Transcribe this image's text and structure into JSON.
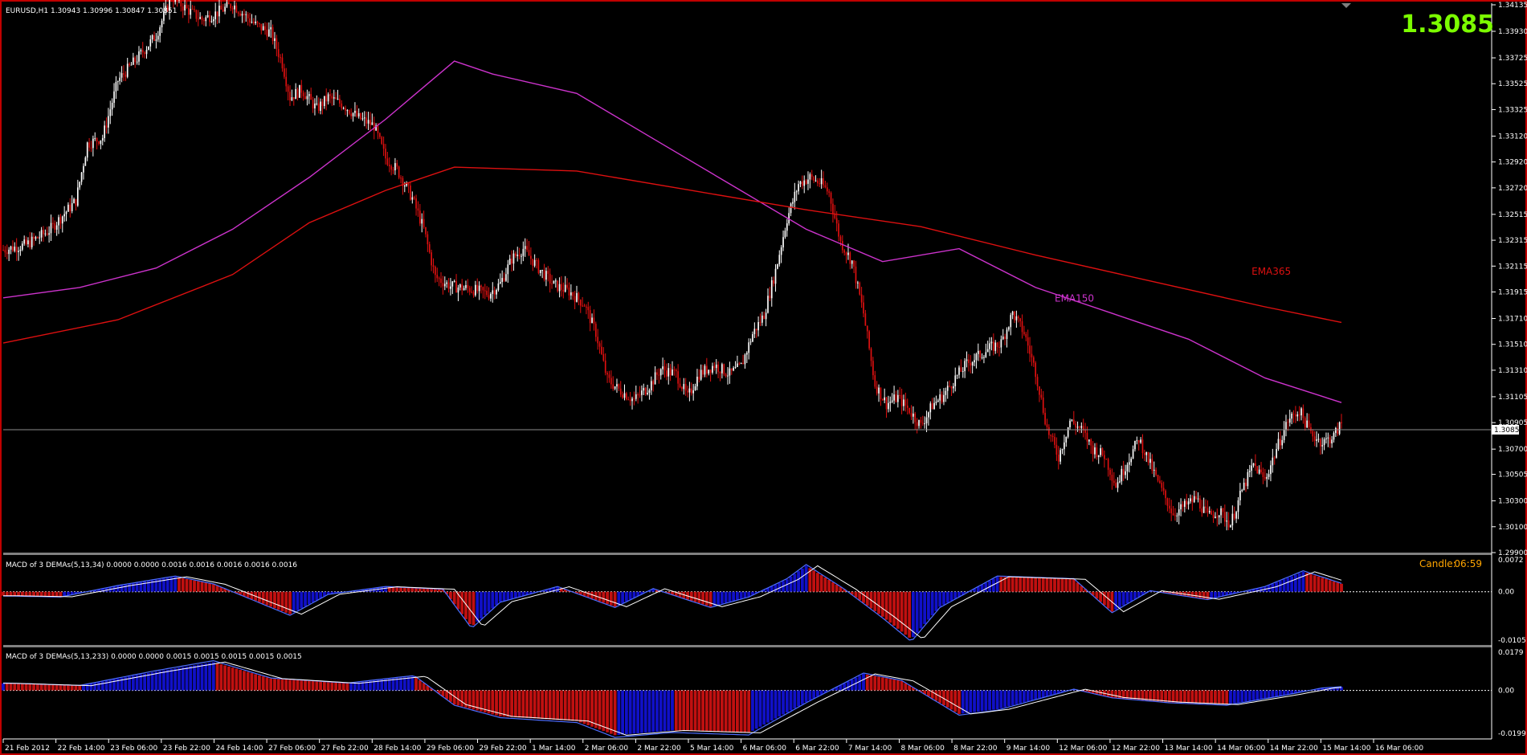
{
  "chart_data": {
    "type": "candlestick",
    "symbol_header": "EURUSD,H1  1.30943 1.30996 1.30847 1.30851",
    "big_price": "1.3085",
    "current_price_label": "1.3085",
    "colors": {
      "bull": "#ffffff",
      "bear": "#e01010",
      "ema150": "#cc33cc",
      "ema365": "#dd1010",
      "accent": "#7cfc00",
      "hist_bull": "#1010c8",
      "hist_bear": "#c01010"
    },
    "price_axis_ticks": [
      "1.34135",
      "1.33930",
      "1.33725",
      "1.33525",
      "1.33325",
      "1.33120",
      "1.32920",
      "1.32720",
      "1.32515",
      "1.32315",
      "1.32115",
      "1.31915",
      "1.31710",
      "1.31510",
      "1.31310",
      "1.31105",
      "1.30905",
      "1.30700",
      "1.30505",
      "1.30300",
      "1.30100",
      "1.29900"
    ],
    "ylim": [
      1.299,
      1.34135
    ],
    "time_labels": [
      "21 Feb 2012",
      "22 Feb 14:00",
      "23 Feb 06:00",
      "23 Feb 22:00",
      "24 Feb 14:00",
      "27 Feb 06:00",
      "27 Feb 22:00",
      "28 Feb 14:00",
      "29 Feb 06:00",
      "29 Feb 22:00",
      "1 Mar 14:00",
      "2 Mar 06:00",
      "2 Mar 22:00",
      "5 Mar 14:00",
      "6 Mar 06:00",
      "6 Mar 22:00",
      "7 Mar 14:00",
      "8 Mar 06:00",
      "8 Mar 22:00",
      "9 Mar 14:00",
      "12 Mar 06:00",
      "12 Mar 22:00",
      "13 Mar 14:00",
      "14 Mar 06:00",
      "14 Mar 22:00",
      "15 Mar 14:00",
      "16 Mar 06:00"
    ],
    "close_path": [
      [
        0,
        1.3224
      ],
      [
        12,
        1.3228
      ],
      [
        24,
        1.3239
      ],
      [
        38,
        1.3262
      ],
      [
        44,
        1.3306
      ],
      [
        52,
        1.3311
      ],
      [
        60,
        1.3355
      ],
      [
        70,
        1.3372
      ],
      [
        80,
        1.339
      ],
      [
        88,
        1.342
      ],
      [
        96,
        1.341
      ],
      [
        104,
        1.3402
      ],
      [
        110,
        1.3406
      ],
      [
        120,
        1.3414
      ],
      [
        132,
        1.3398
      ],
      [
        140,
        1.3392
      ],
      [
        146,
        1.3368
      ],
      [
        150,
        1.3342
      ],
      [
        156,
        1.3348
      ],
      [
        164,
        1.3333
      ],
      [
        170,
        1.3342
      ],
      [
        178,
        1.3336
      ],
      [
        186,
        1.3326
      ],
      [
        194,
        1.332
      ],
      [
        200,
        1.3295
      ],
      [
        206,
        1.3286
      ],
      [
        214,
        1.3264
      ],
      [
        220,
        1.324
      ],
      [
        226,
        1.3203
      ],
      [
        234,
        1.3196
      ],
      [
        244,
        1.3194
      ],
      [
        254,
        1.319
      ],
      [
        260,
        1.3198
      ],
      [
        266,
        1.3217
      ],
      [
        272,
        1.3225
      ],
      [
        280,
        1.321
      ],
      [
        288,
        1.3197
      ],
      [
        296,
        1.3192
      ],
      [
        304,
        1.3182
      ],
      [
        310,
        1.316
      ],
      [
        316,
        1.3124
      ],
      [
        322,
        1.3116
      ],
      [
        330,
        1.3108
      ],
      [
        338,
        1.3119
      ],
      [
        344,
        1.3132
      ],
      [
        352,
        1.3128
      ],
      [
        358,
        1.311
      ],
      [
        364,
        1.3128
      ],
      [
        372,
        1.3135
      ],
      [
        380,
        1.3128
      ],
      [
        386,
        1.3134
      ],
      [
        392,
        1.3159
      ],
      [
        398,
        1.3174
      ],
      [
        404,
        1.3208
      ],
      [
        410,
        1.3248
      ],
      [
        416,
        1.3275
      ],
      [
        422,
        1.328
      ],
      [
        428,
        1.3275
      ],
      [
        432,
        1.3268
      ],
      [
        438,
        1.323
      ],
      [
        444,
        1.3215
      ],
      [
        450,
        1.3175
      ],
      [
        456,
        1.312
      ],
      [
        462,
        1.3105
      ],
      [
        468,
        1.311
      ],
      [
        474,
        1.31
      ],
      [
        480,
        1.3088
      ],
      [
        486,
        1.3104
      ],
      [
        492,
        1.3112
      ],
      [
        498,
        1.3125
      ],
      [
        504,
        1.3136
      ],
      [
        510,
        1.3142
      ],
      [
        516,
        1.3148
      ],
      [
        522,
        1.3152
      ],
      [
        528,
        1.3175
      ],
      [
        534,
        1.316
      ],
      [
        540,
        1.313
      ],
      [
        546,
        1.3086
      ],
      [
        552,
        1.3064
      ],
      [
        558,
        1.3092
      ],
      [
        564,
        1.3085
      ],
      [
        570,
        1.307
      ],
      [
        576,
        1.3065
      ],
      [
        582,
        1.3042
      ],
      [
        588,
        1.306
      ],
      [
        594,
        1.3078
      ],
      [
        600,
        1.3058
      ],
      [
        606,
        1.3038
      ],
      [
        612,
        1.302
      ],
      [
        618,
        1.3026
      ],
      [
        624,
        1.3032
      ],
      [
        630,
        1.3018
      ],
      [
        636,
        1.3022
      ],
      [
        642,
        1.3012
      ],
      [
        648,
        1.3038
      ],
      [
        654,
        1.3058
      ],
      [
        660,
        1.3046
      ],
      [
        666,
        1.307
      ],
      [
        672,
        1.3092
      ],
      [
        678,
        1.31
      ],
      [
        684,
        1.3082
      ],
      [
        690,
        1.3075
      ],
      [
        696,
        1.308
      ],
      [
        700,
        1.309
      ]
    ],
    "series": [
      {
        "name": "EMA150",
        "points": [
          [
            0,
            1.3187
          ],
          [
            40,
            1.3195
          ],
          [
            80,
            1.321
          ],
          [
            120,
            1.324
          ],
          [
            160,
            1.328
          ],
          [
            200,
            1.3325
          ],
          [
            236,
            1.337
          ],
          [
            256,
            1.336
          ],
          [
            300,
            1.3345
          ],
          [
            340,
            1.331
          ],
          [
            380,
            1.3275
          ],
          [
            420,
            1.324
          ],
          [
            460,
            1.3215
          ],
          [
            500,
            1.3225
          ],
          [
            540,
            1.3195
          ],
          [
            580,
            1.3175
          ],
          [
            620,
            1.3155
          ],
          [
            660,
            1.3125
          ],
          [
            700,
            1.3106
          ]
        ]
      },
      {
        "name": "EMA365",
        "points": [
          [
            0,
            1.3152
          ],
          [
            60,
            1.317
          ],
          [
            120,
            1.3205
          ],
          [
            160,
            1.3245
          ],
          [
            200,
            1.327
          ],
          [
            236,
            1.3288
          ],
          [
            300,
            1.3285
          ],
          [
            360,
            1.327
          ],
          [
            420,
            1.3255
          ],
          [
            480,
            1.3242
          ],
          [
            540,
            1.322
          ],
          [
            600,
            1.32
          ],
          [
            660,
            1.318
          ],
          [
            700,
            1.3168
          ]
        ]
      }
    ],
    "ema150_label": "EMA150",
    "ema365_label": "EMA365",
    "macd1": {
      "title": "MACD of 3 DEMAs(5,13,34) 0.0000 0.0000 0.0016 0.0016 0.0016 0.0016 0.0016",
      "ylim": [
        -0.0105,
        0.0072
      ],
      "ticks": [
        "0.0072",
        "0.00",
        "-0.0105"
      ],
      "candle_label": "Candle:",
      "candle_time": "06:59",
      "path": [
        [
          0,
          -0.0008
        ],
        [
          30,
          -0.001
        ],
        [
          60,
          0.0012
        ],
        [
          90,
          0.003
        ],
        [
          110,
          0.0015
        ],
        [
          130,
          -0.0015
        ],
        [
          150,
          -0.0045
        ],
        [
          170,
          -0.0005
        ],
        [
          200,
          0.001
        ],
        [
          230,
          0.0005
        ],
        [
          245,
          -0.007
        ],
        [
          260,
          -0.002
        ],
        [
          290,
          0.001
        ],
        [
          320,
          -0.003
        ],
        [
          340,
          0.0006
        ],
        [
          370,
          -0.003
        ],
        [
          390,
          -0.001
        ],
        [
          410,
          0.0025
        ],
        [
          420,
          0.0052
        ],
        [
          440,
          0.0005
        ],
        [
          460,
          -0.005
        ],
        [
          475,
          -0.0095
        ],
        [
          490,
          -0.003
        ],
        [
          520,
          0.003
        ],
        [
          560,
          0.0025
        ],
        [
          580,
          -0.004
        ],
        [
          600,
          0.0002
        ],
        [
          630,
          -0.0015
        ],
        [
          660,
          0.001
        ],
        [
          680,
          0.004
        ],
        [
          700,
          0.0016
        ]
      ]
    },
    "macd2": {
      "title": "MACD of 3 DEMAs(5,13,233) 0.0000 0.0000 0.0015 0.0015 0.0015 0.0015 0.0015",
      "ylim": [
        -0.0199,
        0.0179
      ],
      "ticks": [
        "0.0179",
        "0.00",
        "-0.0199"
      ],
      "path": [
        [
          0,
          0.003
        ],
        [
          40,
          0.002
        ],
        [
          80,
          0.008
        ],
        [
          110,
          0.012
        ],
        [
          140,
          0.005
        ],
        [
          180,
          0.003
        ],
        [
          215,
          0.006
        ],
        [
          236,
          -0.006
        ],
        [
          260,
          -0.011
        ],
        [
          300,
          -0.013
        ],
        [
          320,
          -0.019
        ],
        [
          350,
          -0.017
        ],
        [
          390,
          -0.018
        ],
        [
          420,
          -0.005
        ],
        [
          450,
          0.007
        ],
        [
          470,
          0.004
        ],
        [
          500,
          -0.01
        ],
        [
          520,
          -0.008
        ],
        [
          560,
          0.0005
        ],
        [
          580,
          -0.003
        ],
        [
          610,
          -0.005
        ],
        [
          640,
          -0.006
        ],
        [
          670,
          -0.002
        ],
        [
          690,
          0.001
        ],
        [
          700,
          0.0015
        ]
      ]
    }
  }
}
